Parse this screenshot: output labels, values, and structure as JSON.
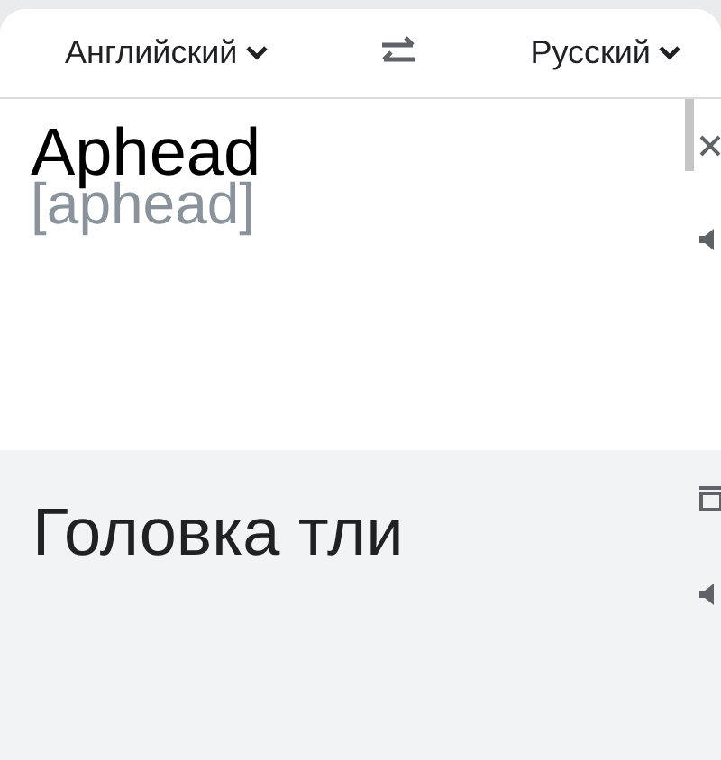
{
  "header": {
    "source_language": "Английский",
    "target_language": "Русский"
  },
  "source": {
    "text": "Aphead",
    "transcription": "[aphead]"
  },
  "translation": {
    "text": "Головка тли"
  }
}
